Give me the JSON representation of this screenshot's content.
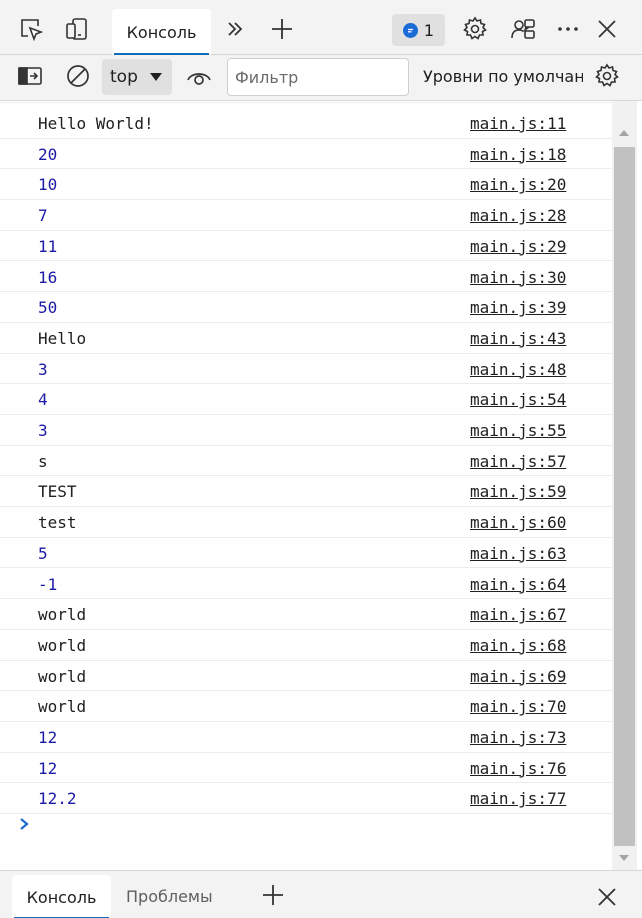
{
  "toolbar_top": {
    "tabs": [
      {
        "label": "Консоль",
        "active": true
      }
    ],
    "messages_count": "1",
    "accent_color": "#0f6cbd"
  },
  "toolbar_filter": {
    "context": "top",
    "filter_placeholder": "Фильтр",
    "levels_label": "Уровни по умолчан"
  },
  "console": {
    "string_color": "#202020",
    "number_color": "#1a1aa6",
    "logs": [
      {
        "value": "Hello World!",
        "type": "string",
        "source": "main.js:11"
      },
      {
        "value": "20",
        "type": "number",
        "source": "main.js:18"
      },
      {
        "value": "10",
        "type": "number",
        "source": "main.js:20"
      },
      {
        "value": "7",
        "type": "number",
        "source": "main.js:28"
      },
      {
        "value": "11",
        "type": "number",
        "source": "main.js:29"
      },
      {
        "value": "16",
        "type": "number",
        "source": "main.js:30"
      },
      {
        "value": "50",
        "type": "number",
        "source": "main.js:39"
      },
      {
        "value": "Hello",
        "type": "string",
        "source": "main.js:43"
      },
      {
        "value": "3",
        "type": "number",
        "source": "main.js:48"
      },
      {
        "value": "4",
        "type": "number",
        "source": "main.js:54"
      },
      {
        "value": "3",
        "type": "number",
        "source": "main.js:55"
      },
      {
        "value": "s",
        "type": "string",
        "source": "main.js:57"
      },
      {
        "value": "TEST",
        "type": "string",
        "source": "main.js:59"
      },
      {
        "value": "test",
        "type": "string",
        "source": "main.js:60"
      },
      {
        "value": "5",
        "type": "number",
        "source": "main.js:63"
      },
      {
        "value": "-1",
        "type": "number",
        "source": "main.js:64"
      },
      {
        "value": "world",
        "type": "string",
        "source": "main.js:67"
      },
      {
        "value": "world",
        "type": "string",
        "source": "main.js:68"
      },
      {
        "value": "world",
        "type": "string",
        "source": "main.js:69"
      },
      {
        "value": "world",
        "type": "string",
        "source": "main.js:70"
      },
      {
        "value": "12",
        "type": "number",
        "source": "main.js:73"
      },
      {
        "value": "12",
        "type": "number",
        "source": "main.js:76"
      },
      {
        "value": "12.2",
        "type": "number",
        "source": "main.js:77"
      }
    ]
  },
  "drawer": {
    "tabs": [
      {
        "label": "Консоль",
        "active": true
      },
      {
        "label": "Проблемы",
        "active": false
      }
    ]
  }
}
